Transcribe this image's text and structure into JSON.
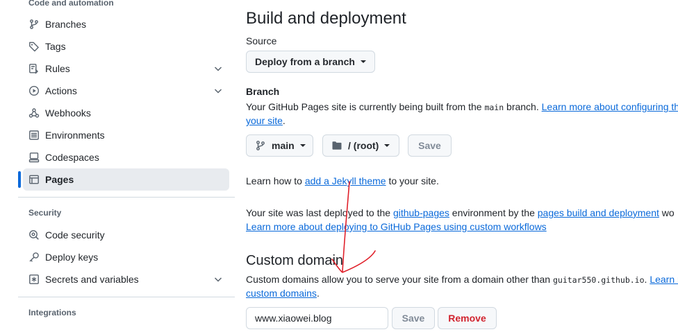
{
  "sidebar": {
    "code_automation_heading": "Code and automation",
    "items": [
      {
        "label": "Branches",
        "icon": "branch-icon"
      },
      {
        "label": "Tags",
        "icon": "tag-icon"
      },
      {
        "label": "Rules",
        "icon": "rules-icon",
        "expandable": true
      },
      {
        "label": "Actions",
        "icon": "actions-icon",
        "expandable": true
      },
      {
        "label": "Webhooks",
        "icon": "webhooks-icon"
      },
      {
        "label": "Environments",
        "icon": "environments-icon"
      },
      {
        "label": "Codespaces",
        "icon": "codespaces-icon"
      },
      {
        "label": "Pages",
        "icon": "pages-icon",
        "active": true
      }
    ],
    "security_heading": "Security",
    "security_items": [
      {
        "label": "Code security",
        "icon": "code-security-icon"
      },
      {
        "label": "Deploy keys",
        "icon": "key-icon"
      },
      {
        "label": "Secrets and variables",
        "icon": "secrets-icon",
        "expandable": true
      }
    ],
    "integrations_heading": "Integrations"
  },
  "build": {
    "title": "Build and deployment",
    "source_label": "Source",
    "source_value": "Deploy from a branch",
    "branch_label": "Branch",
    "branch_desc_prefix": "Your GitHub Pages site is currently being built from the ",
    "branch_desc_code": "main",
    "branch_desc_mid": " branch. ",
    "branch_desc_link1": "Learn more about configuring th",
    "branch_desc_link2": "your site",
    "branch_desc_end": ".",
    "branch_button": "main",
    "folder_button": "/ (root)",
    "save_button": "Save",
    "jekyll_prefix": "Learn how to ",
    "jekyll_link": "add a Jekyll theme",
    "jekyll_suffix": " to your site.",
    "deployed_prefix": "Your site was last deployed to the ",
    "deployed_link1": "github-pages",
    "deployed_mid": " environment by the ",
    "deployed_link2": "pages build and deployment",
    "deployed_suffix": " wo",
    "workflows_link": "Learn more about deploying to GitHub Pages using custom workflows"
  },
  "custom_domain": {
    "title": "Custom domain",
    "desc_prefix": "Custom domains allow you to serve your site from a domain other than ",
    "desc_code": "guitar550.github.io",
    "desc_mid": ". ",
    "desc_link1": "Learn m",
    "desc_link2": "custom domains",
    "desc_end": ".",
    "input_value": "www.xiaowei.blog",
    "save_button": "Save",
    "remove_button": "Remove"
  },
  "colors": {
    "accent": "#0969da",
    "danger": "#d1242f",
    "annotation": "#e0212b"
  }
}
